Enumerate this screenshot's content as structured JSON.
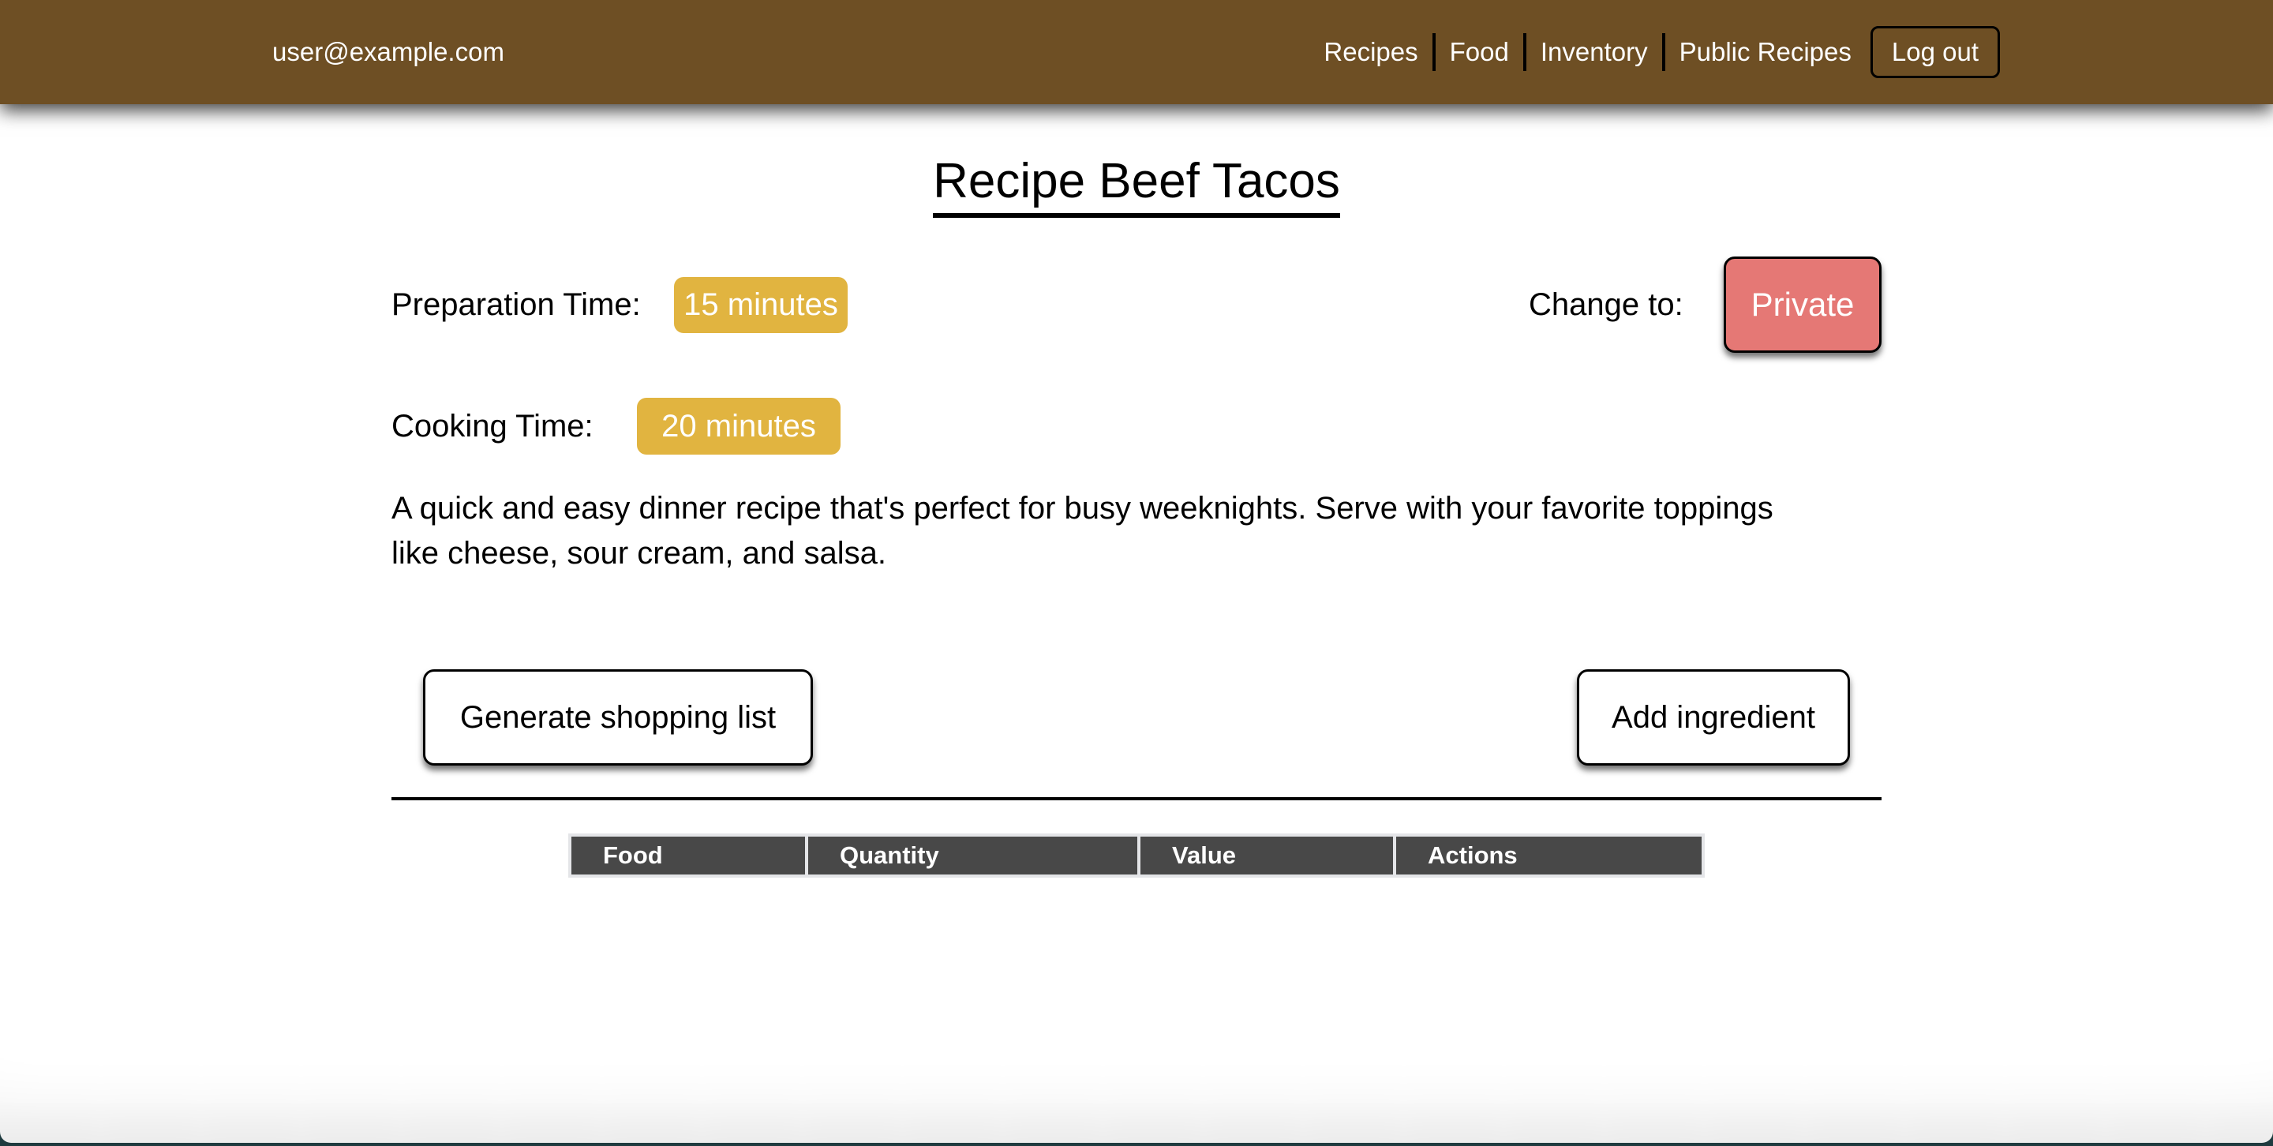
{
  "navbar": {
    "user_email": "user@example.com",
    "links": [
      {
        "label": "Recipes"
      },
      {
        "label": "Food"
      },
      {
        "label": "Inventory"
      },
      {
        "label": "Public Recipes"
      }
    ],
    "logout_label": "Log out",
    "background_color": "#6e4f24"
  },
  "recipe": {
    "title": "Recipe Beef Tacos",
    "preparation_label": "Preparation Time:",
    "preparation_value": "15 minutes",
    "cooking_label": "Cooking Time:",
    "cooking_value": "20 minutes",
    "visibility_label": "Change to:",
    "visibility_button": "Private",
    "description": "A quick and easy dinner recipe that's perfect for busy weeknights. Serve with your favorite toppings like cheese, sour cream, and salsa.",
    "badge_color": "#e1b440",
    "private_color": "#e57875"
  },
  "actions": {
    "shopping_list_label": "Generate shopping list",
    "add_ingredient_label": "Add ingredient"
  },
  "ingredients_table": {
    "columns": [
      "Food",
      "Quantity",
      "Value",
      "Actions"
    ],
    "rows": []
  }
}
